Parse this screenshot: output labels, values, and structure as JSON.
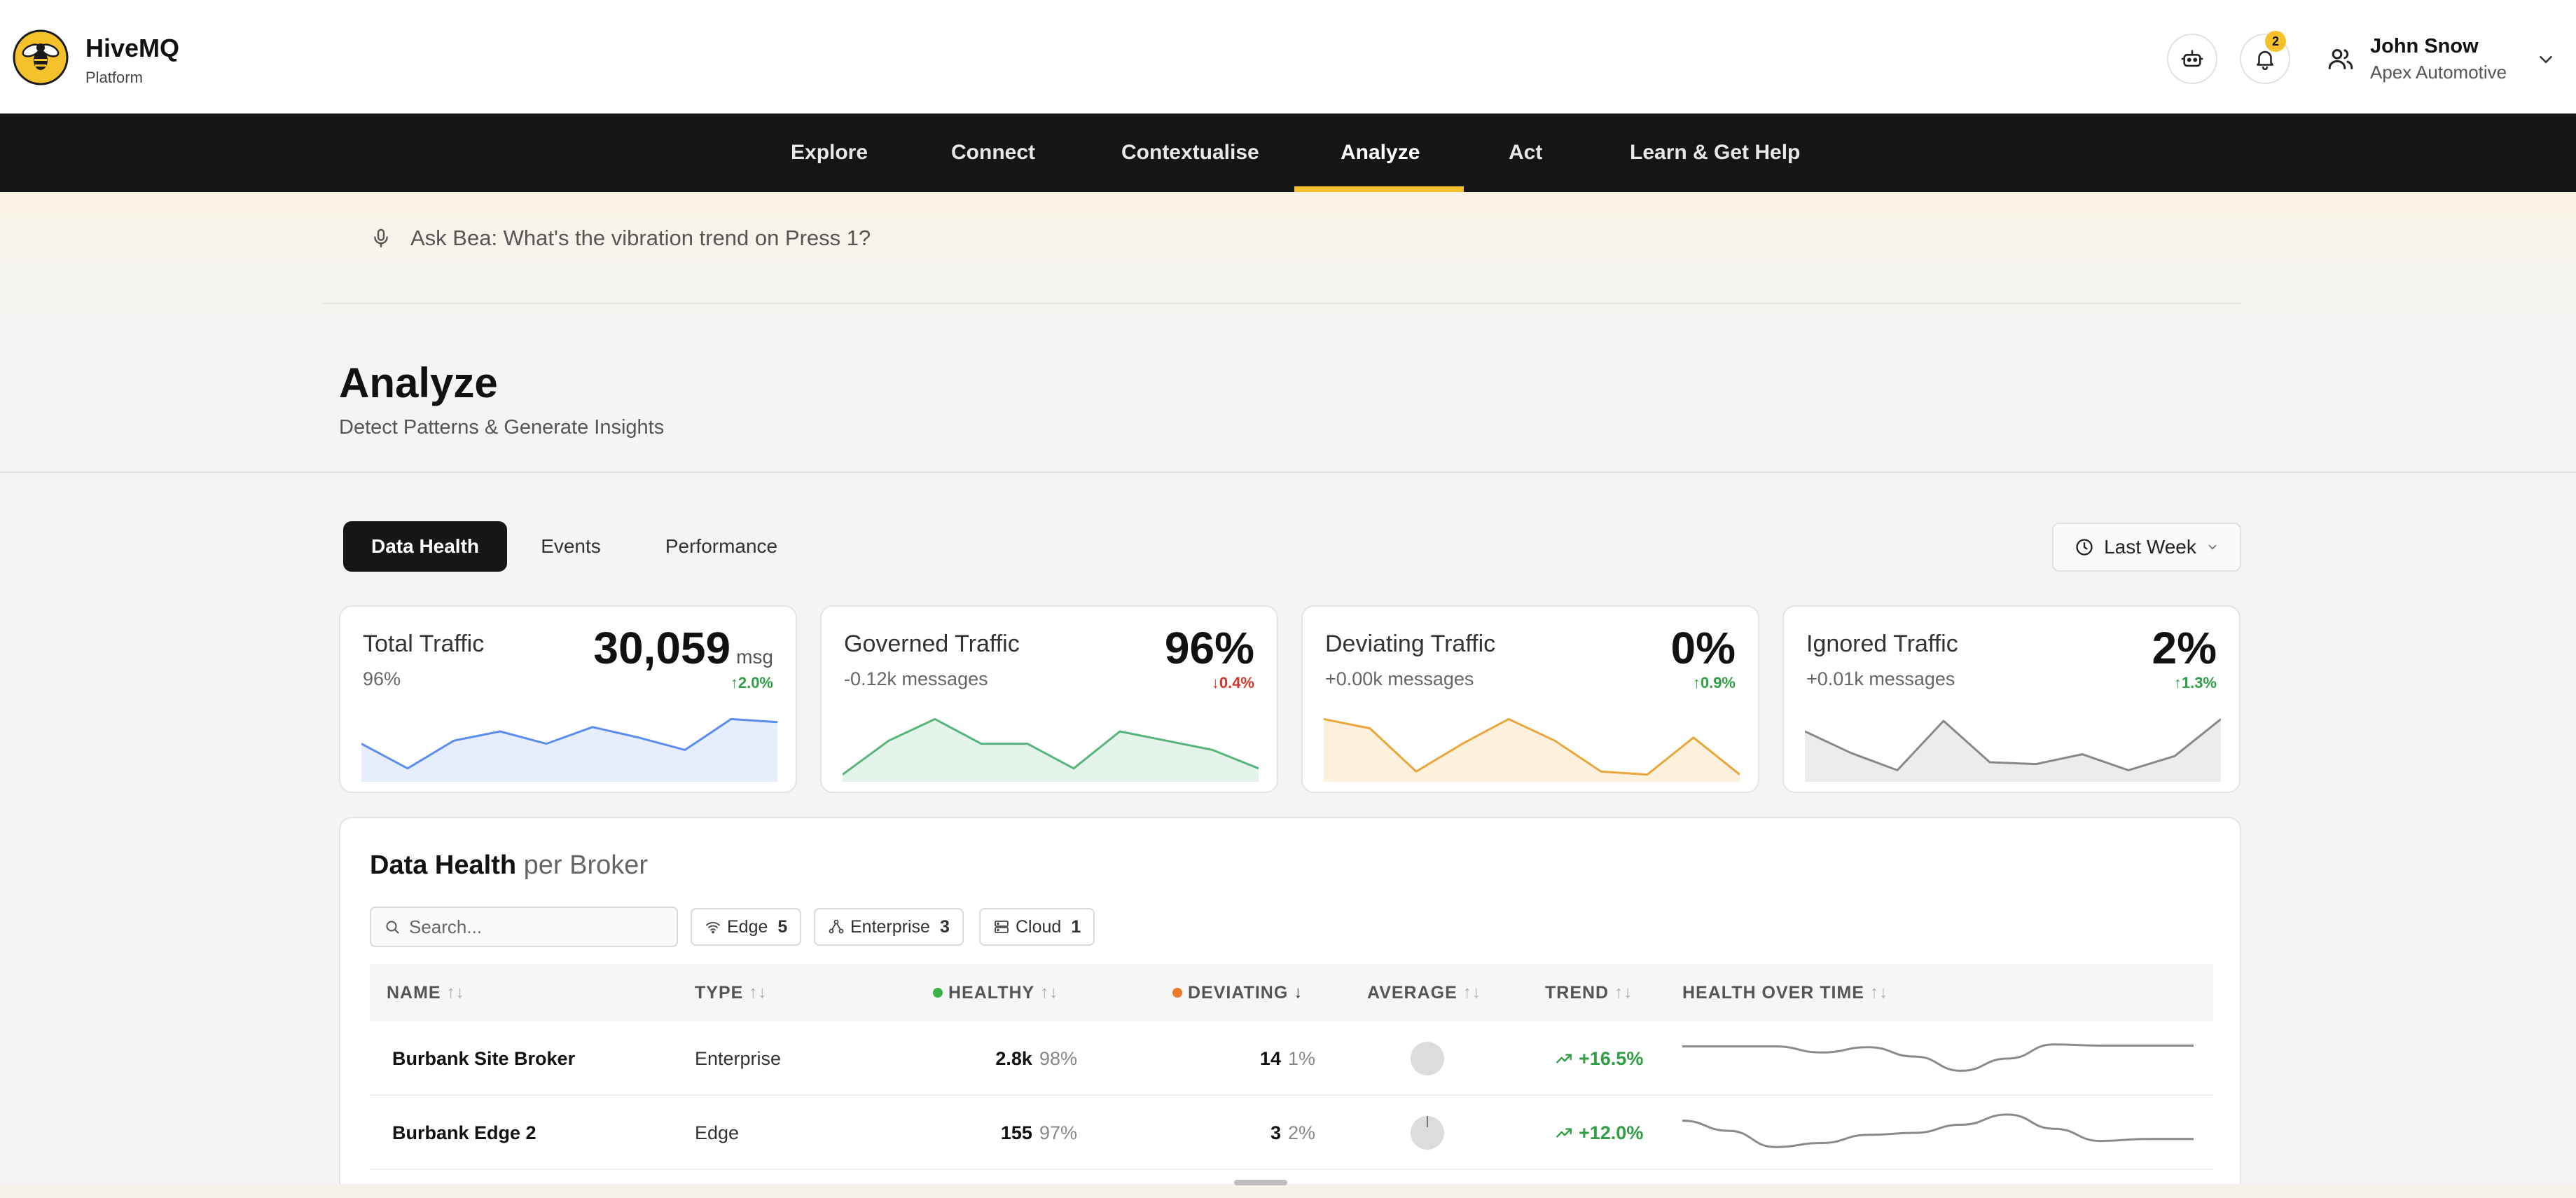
{
  "header": {
    "brand_name": "HiveMQ",
    "brand_sub": "Platform",
    "notification_count": "2",
    "user_name": "John Snow",
    "user_org": "Apex Automotive"
  },
  "nav": {
    "items": [
      {
        "label": "Explore"
      },
      {
        "label": "Connect"
      },
      {
        "label": "Contextualise"
      },
      {
        "label": "Analyze"
      },
      {
        "label": "Act"
      },
      {
        "label": "Learn & Get Help"
      }
    ],
    "active": "Analyze"
  },
  "ask": {
    "text": "Ask Bea: What's the vibration trend on Press 1?"
  },
  "page": {
    "title": "Analyze",
    "subtitle": "Detect Patterns & Generate Insights"
  },
  "tabs": [
    {
      "label": "Data Health"
    },
    {
      "label": "Events"
    },
    {
      "label": "Performance"
    }
  ],
  "range": {
    "label": "Last Week"
  },
  "kpis": [
    {
      "label": "Total Traffic",
      "sub": "96%",
      "value": "30,059",
      "unit": "msg",
      "delta": "2.0%",
      "direction": "up",
      "spark": [
        0.55,
        0.15,
        0.6,
        0.75,
        0.55,
        0.82,
        0.65,
        0.45,
        0.95,
        0.9
      ],
      "color": "#5b8def",
      "fill": "#e6edfd"
    },
    {
      "label": "Governed Traffic",
      "sub": "-0.12k messages",
      "value": "96%",
      "unit": "",
      "delta": "0.4%",
      "direction": "down",
      "spark": [
        0.05,
        0.6,
        0.95,
        0.55,
        0.55,
        0.15,
        0.75,
        0.6,
        0.45,
        0.15
      ],
      "color": "#56b47c",
      "fill": "#e5f4ea"
    },
    {
      "label": "Deviating Traffic",
      "sub": "+0.00k messages",
      "value": "0%",
      "unit": "",
      "delta": "0.9%",
      "direction": "up",
      "spark": [
        0.95,
        0.8,
        0.1,
        0.55,
        0.95,
        0.6,
        0.1,
        0.05,
        0.65,
        0.05
      ],
      "color": "#eaa63a",
      "fill": "#fdf0dc"
    },
    {
      "label": "Ignored Traffic",
      "sub": "+0.01k messages",
      "value": "2%",
      "unit": "",
      "delta": "1.3%",
      "direction": "up",
      "spark": [
        0.75,
        0.4,
        0.12,
        0.92,
        0.25,
        0.22,
        0.38,
        0.12,
        0.35,
        0.95
      ],
      "color": "#888888",
      "fill": "#ececed"
    }
  ],
  "panel": {
    "title_bold": "Data Health",
    "title_rest": "per Broker",
    "search_placeholder": "Search...",
    "chips": [
      {
        "label": "Edge",
        "count": "5"
      },
      {
        "label": "Enterprise",
        "count": "3"
      },
      {
        "label": "Cloud",
        "count": "1"
      }
    ],
    "columns": {
      "name": "NAME",
      "type": "TYPE",
      "healthy": "HEALTHY",
      "deviating": "DEVIATING",
      "average": "AVERAGE",
      "trend": "TREND",
      "health_over_time": "HEALTH OVER TIME"
    },
    "rows": [
      {
        "name": "Burbank Site Broker",
        "type": "Enterprise",
        "healthy": "2.8k",
        "healthy_pct": "98%",
        "deviating": "14",
        "deviating_pct": "1%",
        "trend": "+16.5%",
        "health": [
          0.8,
          0.8,
          0.8,
          0.65,
          0.78,
          0.55,
          0.2,
          0.5,
          0.85,
          0.82,
          0.82,
          0.82
        ]
      },
      {
        "name": "Burbank Edge 2",
        "type": "Edge",
        "healthy": "155",
        "healthy_pct": "97%",
        "deviating": "3",
        "deviating_pct": "2%",
        "trend": "+12.0%",
        "health": [
          0.8,
          0.55,
          0.15,
          0.25,
          0.45,
          0.5,
          0.7,
          0.95,
          0.6,
          0.3,
          0.35,
          0.35
        ]
      }
    ]
  },
  "colors": {
    "accent": "#f5c12a",
    "healthy_dot": "#3bb14a",
    "deviating_dot": "#ee7a2a",
    "trend_up": "#2f9e44"
  }
}
